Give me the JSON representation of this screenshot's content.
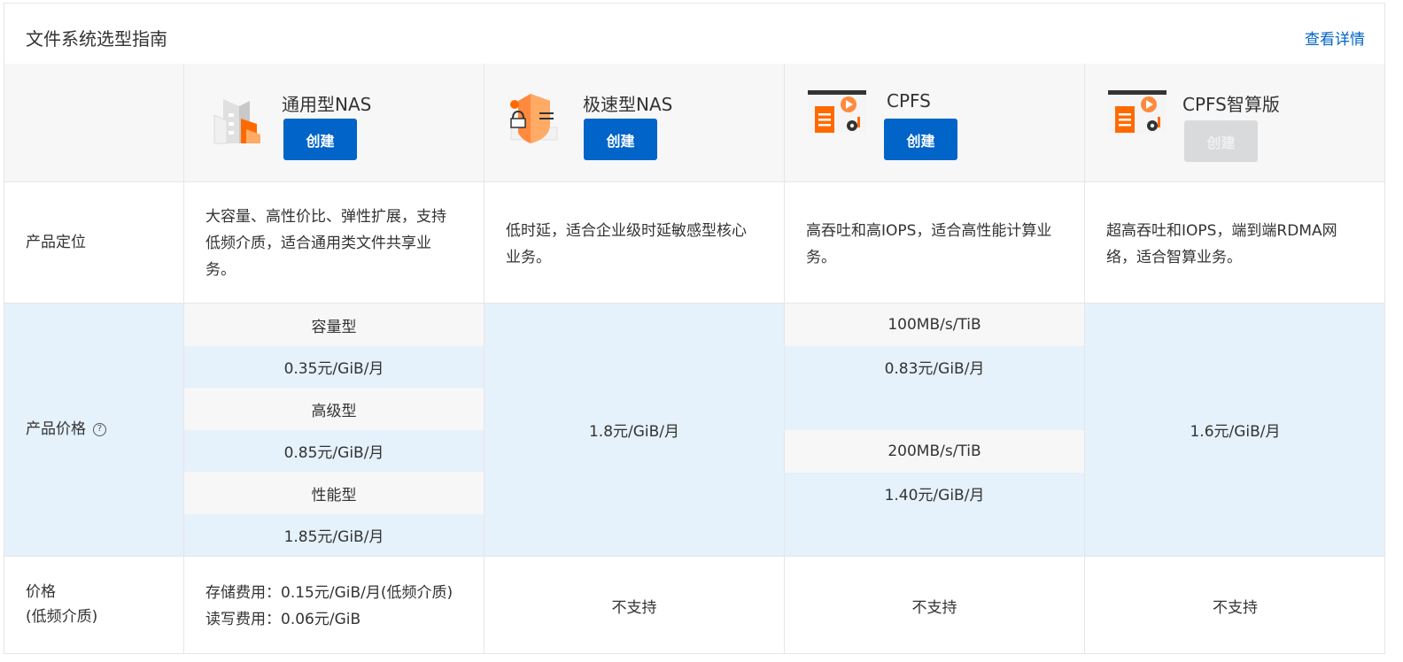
{
  "header": {
    "title": "文件系统选型指南",
    "detail_link": "查看详情"
  },
  "products": [
    {
      "name": "通用型NAS",
      "icon": "building-icon",
      "button": "创建",
      "enabled": true
    },
    {
      "name": "极速型NAS",
      "icon": "shield-lock-icon",
      "button": "创建",
      "enabled": true
    },
    {
      "name": "CPFS",
      "icon": "document-gear-icon",
      "button": "创建",
      "enabled": true
    },
    {
      "name": "CPFS智算版",
      "icon": "document-gear-icon",
      "button": "创建",
      "enabled": false
    }
  ],
  "rows": {
    "positioning": {
      "label": "产品定位",
      "values": [
        [
          "大容量、高性价比、弹性扩展，支持",
          "低频介质，适合通用类文件共享业",
          "务。"
        ],
        [
          "低时延，适合企业级时延敏感型核心",
          "业务。"
        ],
        [
          "高吞吐和高IOPS，适合高性能计算业",
          "务。"
        ],
        [
          "超高吞吐和IOPS，端到端RDMA网",
          "络，适合智算业务。"
        ]
      ]
    },
    "price": {
      "label": "产品价格",
      "help_icon": "?",
      "general_nas": [
        {
          "tier": "容量型",
          "price": "0.35元/GiB/月"
        },
        {
          "tier": "高级型",
          "price": "0.85元/GiB/月"
        },
        {
          "tier": "性能型",
          "price": "1.85元/GiB/月"
        }
      ],
      "extreme_nas": "1.8元/GiB/月",
      "cpfs": [
        {
          "tier": "100MB/s/TiB",
          "price": "0.83元/GiB/月"
        },
        {
          "tier": "200MB/s/TiB",
          "price": "1.40元/GiB/月"
        }
      ],
      "cpfs_ai": "1.6元/GiB/月"
    },
    "low_freq": {
      "label_line1": "价格",
      "label_line2": "(低频介质)",
      "general_nas": [
        "存储费用：0.15元/GiB/月(低频介质)",
        "读写费用：0.06元/GiB"
      ],
      "others": [
        "不支持",
        "不支持",
        "不支持"
      ]
    }
  },
  "colors": {
    "accent": "#0064c8",
    "header_bg": "#f7f7f7",
    "price_bg": "#e5f1fb",
    "icon_orange": "#ff6a00"
  }
}
